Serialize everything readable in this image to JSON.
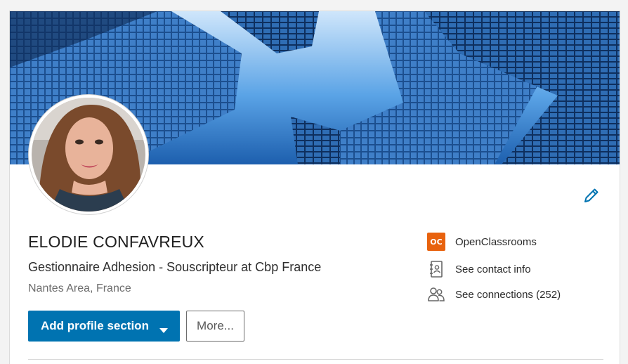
{
  "profile": {
    "name": "ELODIE CONFAVREUX",
    "headline": "Gestionnaire Adhesion - Souscripteur at Cbp France",
    "location": "Nantes Area, France"
  },
  "actions": {
    "add_section_label": "Add profile section",
    "more_label": "More..."
  },
  "sidebar": {
    "company": "OpenClassrooms",
    "company_logo_text": "OC",
    "contact_label": "See contact info",
    "connections_label": "See connections (252)"
  },
  "icons": {
    "edit": "pencil-icon",
    "dropdown": "caret-down-icon",
    "contact": "address-book-icon",
    "connections": "people-icon"
  },
  "colors": {
    "primary": "#0073b1",
    "company_logo": "#e8620e"
  }
}
